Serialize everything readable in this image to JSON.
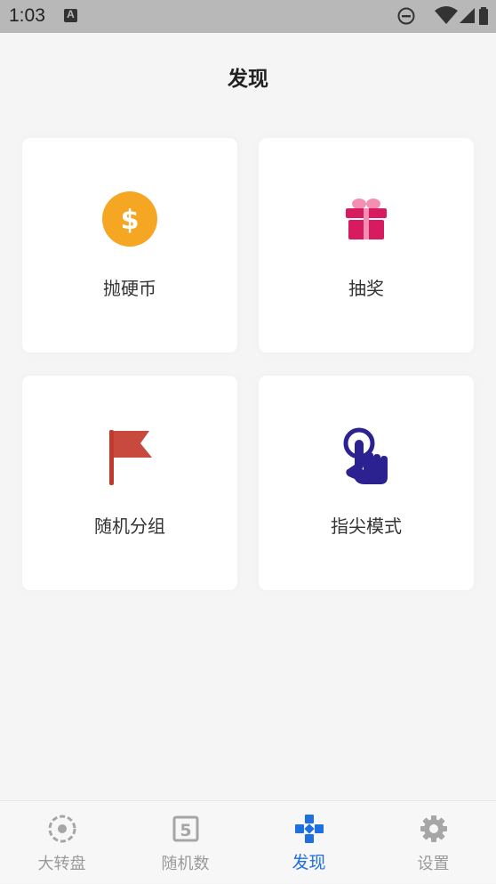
{
  "status": {
    "time": "1:03"
  },
  "header": {
    "title": "发现"
  },
  "cards": [
    {
      "label": "抛硬币",
      "icon": "coin-dollar-icon",
      "color": "#f5a623"
    },
    {
      "label": "抽奖",
      "icon": "gift-icon",
      "color": "#d81b60"
    },
    {
      "label": "随机分组",
      "icon": "flag-icon",
      "color": "#c0392b"
    },
    {
      "label": "指尖模式",
      "icon": "touch-finger-icon",
      "color": "#2b2190"
    }
  ],
  "bottom_nav": {
    "items": [
      {
        "label": "大转盘",
        "icon": "wheel-icon",
        "active": false
      },
      {
        "label": "随机数",
        "icon": "number-five-icon",
        "active": false
      },
      {
        "label": "发现",
        "icon": "gamepad-icon",
        "active": true
      },
      {
        "label": "设置",
        "icon": "gear-icon",
        "active": false
      }
    ],
    "active_color": "#1e6fe0",
    "inactive_color": "#9a9a9a"
  }
}
